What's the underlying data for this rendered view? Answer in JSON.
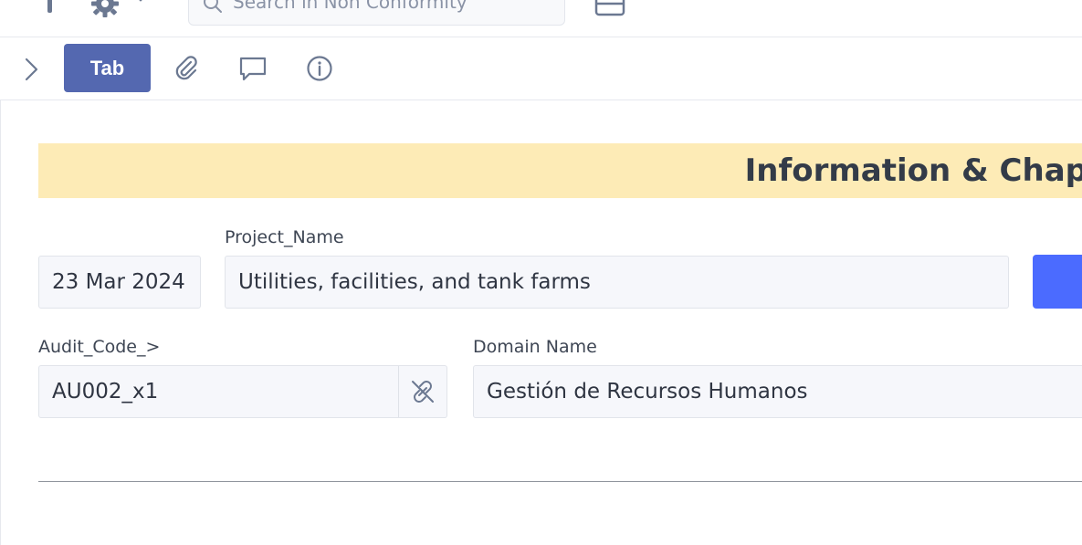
{
  "topbar": {
    "search_placeholder": "Search in Non Conformity"
  },
  "toolbar": {
    "tab_label": "Tab"
  },
  "banner": {
    "title": "Information & Chap"
  },
  "form": {
    "date_value": "23 Mar 2024",
    "project_name_label": "Project_Name",
    "project_name_value": "Utilities, facilities, and tank farms",
    "audit_code_label": "Audit_Code_>",
    "audit_code_value": "AU002_x1",
    "domain_name_label": "Domain Name",
    "domain_name_value": "Gestión de Recursos Humanos"
  },
  "colors": {
    "accent": "#5468b0",
    "primary_button": "#4b6bff",
    "banner_bg": "#fdebb6"
  },
  "icons": [
    "settings-gear-icon",
    "search-icon",
    "layout-icon",
    "chevron-right-icon",
    "paperclip-icon",
    "comment-icon",
    "info-icon",
    "unlink-icon"
  ]
}
